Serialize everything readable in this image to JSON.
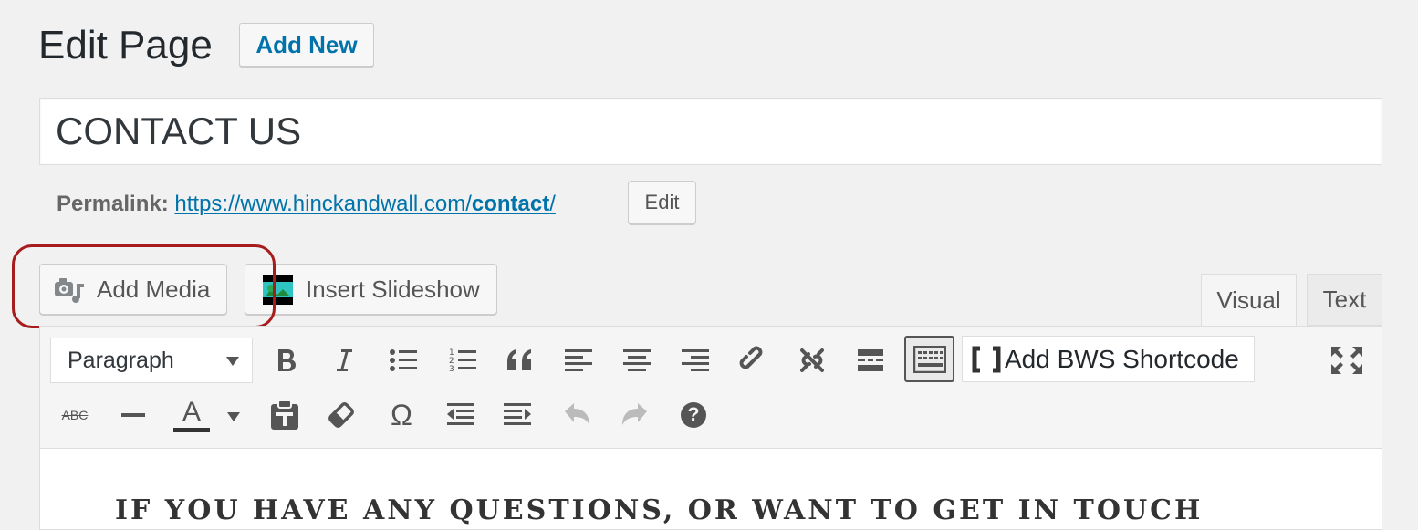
{
  "header": {
    "title": "Edit Page",
    "add_new_label": "Add New"
  },
  "title_field": {
    "value": "CONTACT US"
  },
  "permalink": {
    "label": "Permalink:",
    "url_base": "https://www.hinckandwall.com/",
    "slug": "contact",
    "url_tail": "/",
    "edit_label": "Edit"
  },
  "media_buttons": {
    "add_media_label": "Add Media",
    "insert_slideshow_label": "Insert Slideshow"
  },
  "editor_tabs": {
    "visual_label": "Visual",
    "text_label": "Text",
    "active": "Visual"
  },
  "toolbar": {
    "format_select_value": "Paragraph",
    "bws_shortcode_label": "Add BWS Shortcode",
    "row1_icons": [
      "bold-icon",
      "italic-icon",
      "bulleted-list-icon",
      "numbered-list-icon",
      "blockquote-icon",
      "align-left-icon",
      "align-center-icon",
      "align-right-icon",
      "insert-link-icon",
      "remove-link-icon",
      "read-more-icon",
      "toolbar-toggle-icon",
      "fullscreen-icon"
    ],
    "row2_icons": [
      "strikethrough-icon",
      "horizontal-line-icon",
      "text-color-icon",
      "paste-as-text-icon",
      "clear-formatting-icon",
      "special-character-icon",
      "outdent-icon",
      "indent-icon",
      "undo-icon",
      "redo-icon",
      "help-icon"
    ],
    "strikethrough_glyph": "ABC",
    "text_color_glyph": "A",
    "special_char_glyph": "Ω",
    "help_glyph": "?"
  },
  "editor": {
    "content_line": "IF YOU HAVE ANY QUESTIONS, OR WANT TO GET IN TOUCH"
  },
  "colors": {
    "link": "#0073aa",
    "highlight_border": "#a61c1c",
    "background": "#f1f1f1"
  }
}
